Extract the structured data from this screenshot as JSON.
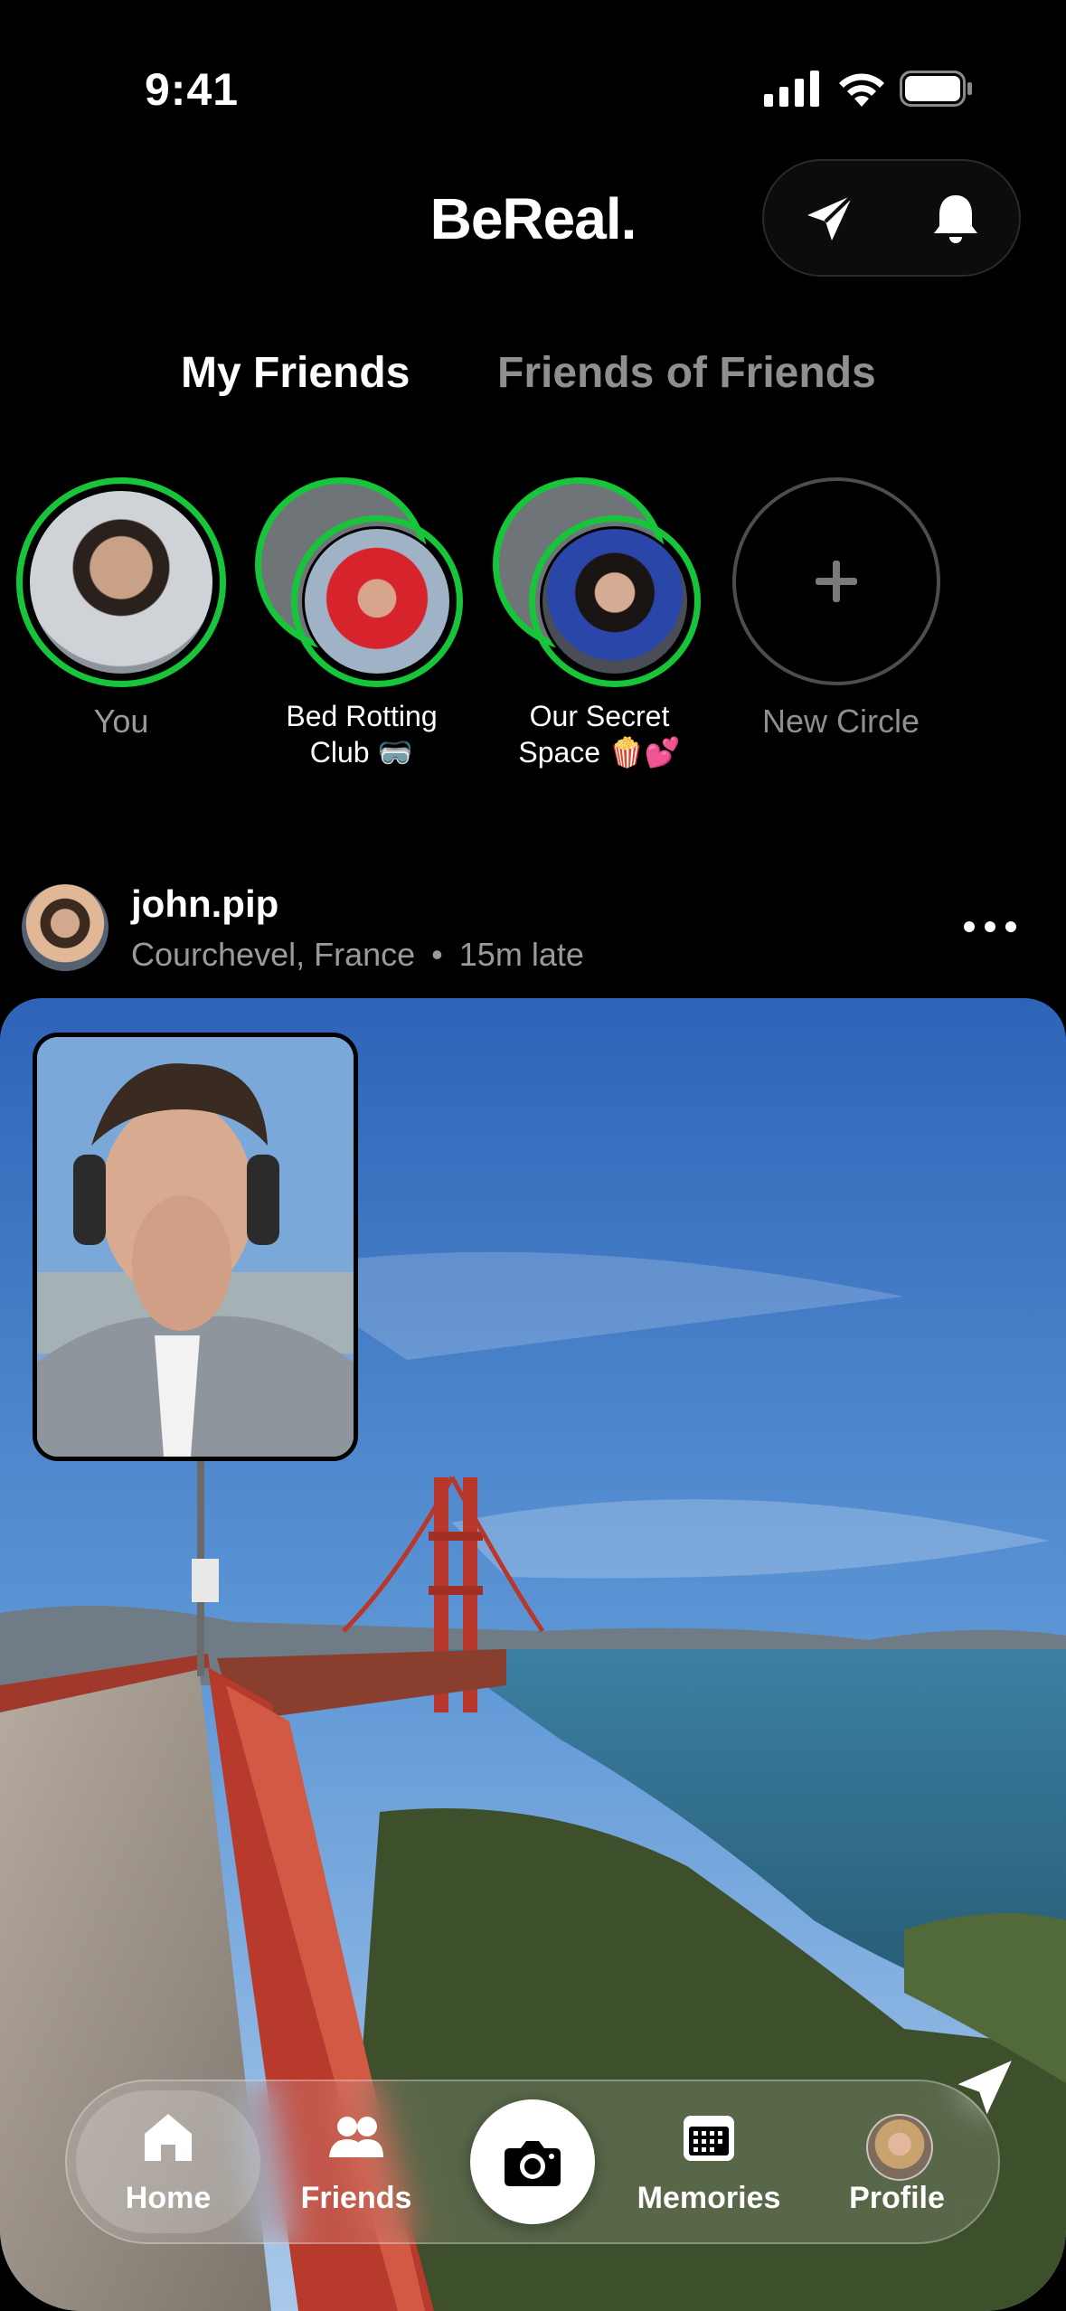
{
  "status_bar": {
    "time": "9:41"
  },
  "header": {
    "brand": "BeReal."
  },
  "feed_tabs": [
    {
      "label": "My Friends",
      "active": true
    },
    {
      "label": "Friends of Friends",
      "active": false
    }
  ],
  "circles": [
    {
      "label": "You"
    },
    {
      "label_line1": "Bed Rotting",
      "label_line2": "Club 🥽"
    },
    {
      "label_line1": "Our Secret",
      "label_line2": "Space 🍿💕"
    },
    {
      "label": "New Circle"
    }
  ],
  "post": {
    "username": "john.pip",
    "location": "Courchevel, France",
    "separator": "•",
    "lateness": "15m late"
  },
  "tab_bar": {
    "home": "Home",
    "friends": "Friends",
    "memories": "Memories",
    "profile": "Profile"
  },
  "colors": {
    "accent_green": "#16c53a",
    "background": "#000000",
    "muted_text": "#8f8f8f"
  },
  "icons": [
    "signal-icon",
    "wifi-icon",
    "battery-icon",
    "paper-plane-icon",
    "bell-icon",
    "plus-icon",
    "more-dots-icon",
    "home-icon",
    "friends-icon",
    "camera-icon",
    "memories-calendar-icon"
  ]
}
